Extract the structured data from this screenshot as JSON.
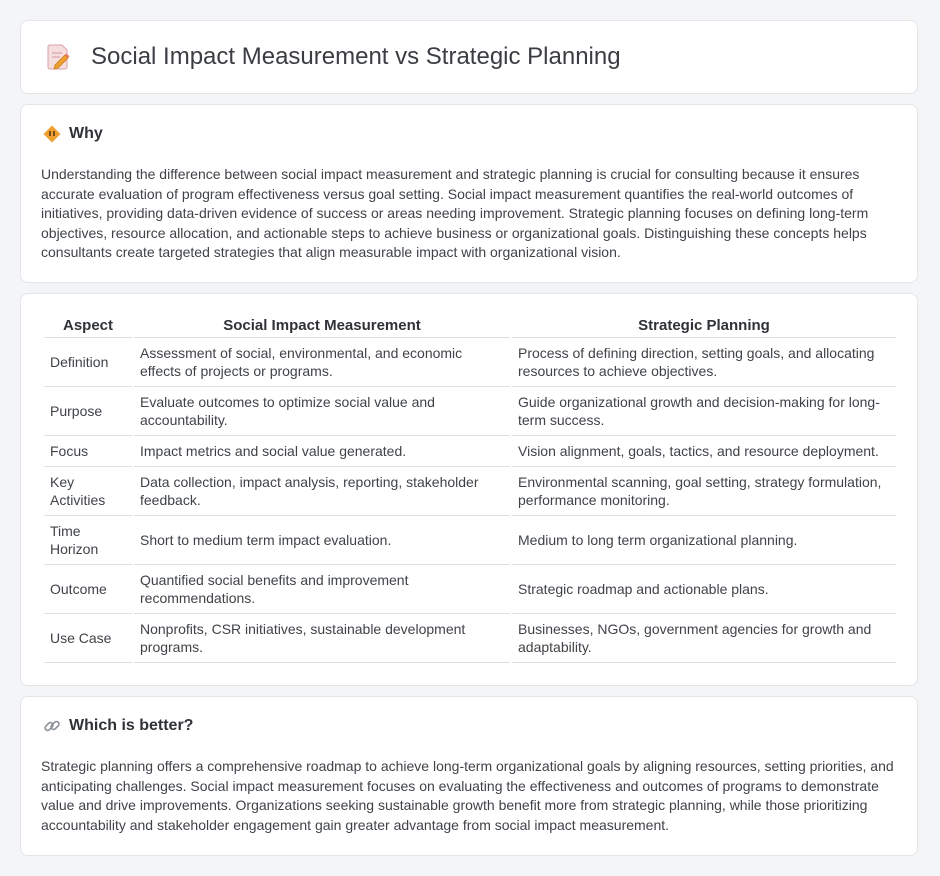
{
  "header": {
    "title": "Social Impact Measurement vs Strategic Planning",
    "icon": "document-pencil-icon"
  },
  "why": {
    "icon": "diamond-warning-icon",
    "title": "Why",
    "text": "Understanding the difference between social impact measurement and strategic planning is crucial for consulting because it ensures accurate evaluation of program effectiveness versus goal setting. Social impact measurement quantifies the real-world outcomes of initiatives, providing data-driven evidence of success or areas needing improvement. Strategic planning focuses on defining long-term objectives, resource allocation, and actionable steps to achieve business or organizational goals. Distinguishing these concepts helps consultants create targeted strategies that align measurable impact with organizational vision."
  },
  "table": {
    "headers": [
      "Aspect",
      "Social Impact Measurement",
      "Strategic Planning"
    ],
    "rows": [
      [
        "Definition",
        "Assessment of social, environmental, and economic effects of projects or programs.",
        "Process of defining direction, setting goals, and allocating resources to achieve objectives."
      ],
      [
        "Purpose",
        "Evaluate outcomes to optimize social value and accountability.",
        "Guide organizational growth and decision-making for long-term success."
      ],
      [
        "Focus",
        "Impact metrics and social value generated.",
        "Vision alignment, goals, tactics, and resource deployment."
      ],
      [
        "Key Activities",
        "Data collection, impact analysis, reporting, stakeholder feedback.",
        "Environmental scanning, goal setting, strategy formulation, performance monitoring."
      ],
      [
        "Time Horizon",
        "Short to medium term impact evaluation.",
        "Medium to long term organizational planning."
      ],
      [
        "Outcome",
        "Quantified social benefits and improvement recommendations.",
        "Strategic roadmap and actionable plans."
      ],
      [
        "Use Case",
        "Nonprofits, CSR initiatives, sustainable development programs.",
        "Businesses, NGOs, government agencies for growth and adaptability."
      ]
    ]
  },
  "better": {
    "icon": "link-icon",
    "title": "Which is better?",
    "text": "Strategic planning offers a comprehensive roadmap to achieve long-term organizational goals by aligning resources, setting priorities, and anticipating challenges. Social impact measurement focuses on evaluating the effectiveness and outcomes of programs to demonstrate value and drive improvements. Organizations seeking sustainable growth benefit more from strategic planning, while those prioritizing accountability and stakeholder engagement gain greater advantage from social impact measurement."
  },
  "colors": {
    "background": "#f4f5f7",
    "card": "#ffffff",
    "text": "#3f4348",
    "icon_orange": "#f0a030",
    "icon_pink": "#e9a0a8"
  }
}
